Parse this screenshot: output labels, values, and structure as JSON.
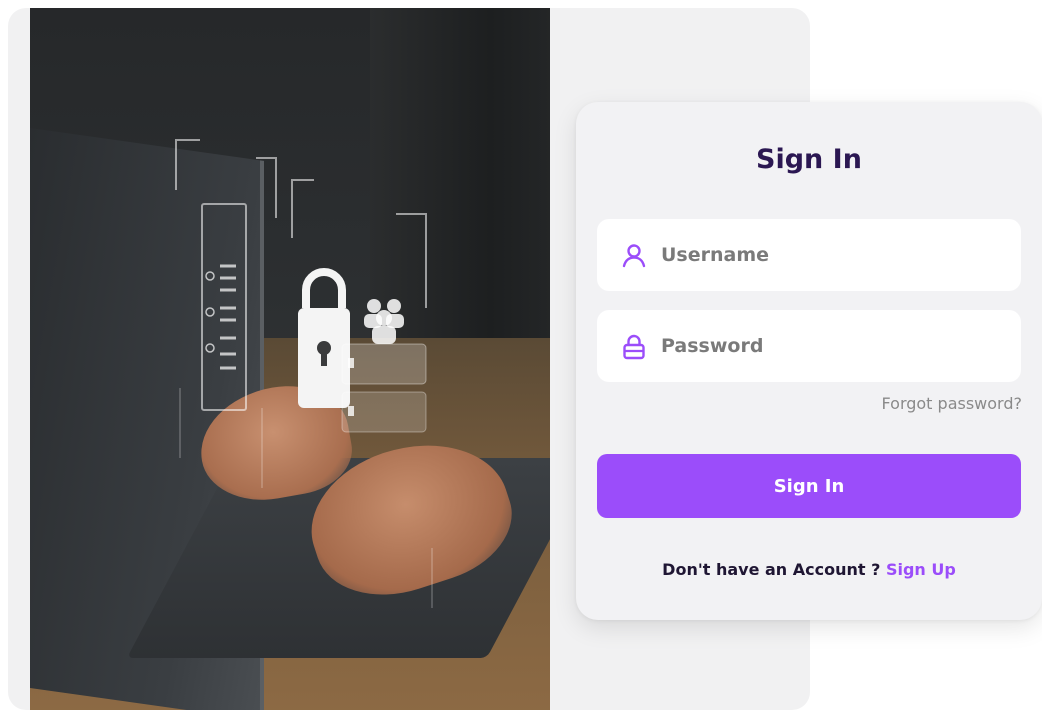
{
  "card": {
    "title": "Sign In",
    "username_placeholder": "Username",
    "password_placeholder": "Password",
    "forgot_label": "Forgot password?",
    "signin_label": "Sign In",
    "no_account_text": "Don't have an Account ?",
    "signup_label": "Sign Up"
  },
  "colors": {
    "accent": "#9b4dfa",
    "title": "#2b1752",
    "card_bg": "#f2f2f4",
    "back_card_bg": "#f1f1f2"
  },
  "icons": {
    "username": "user-icon",
    "password": "lock-icon"
  }
}
